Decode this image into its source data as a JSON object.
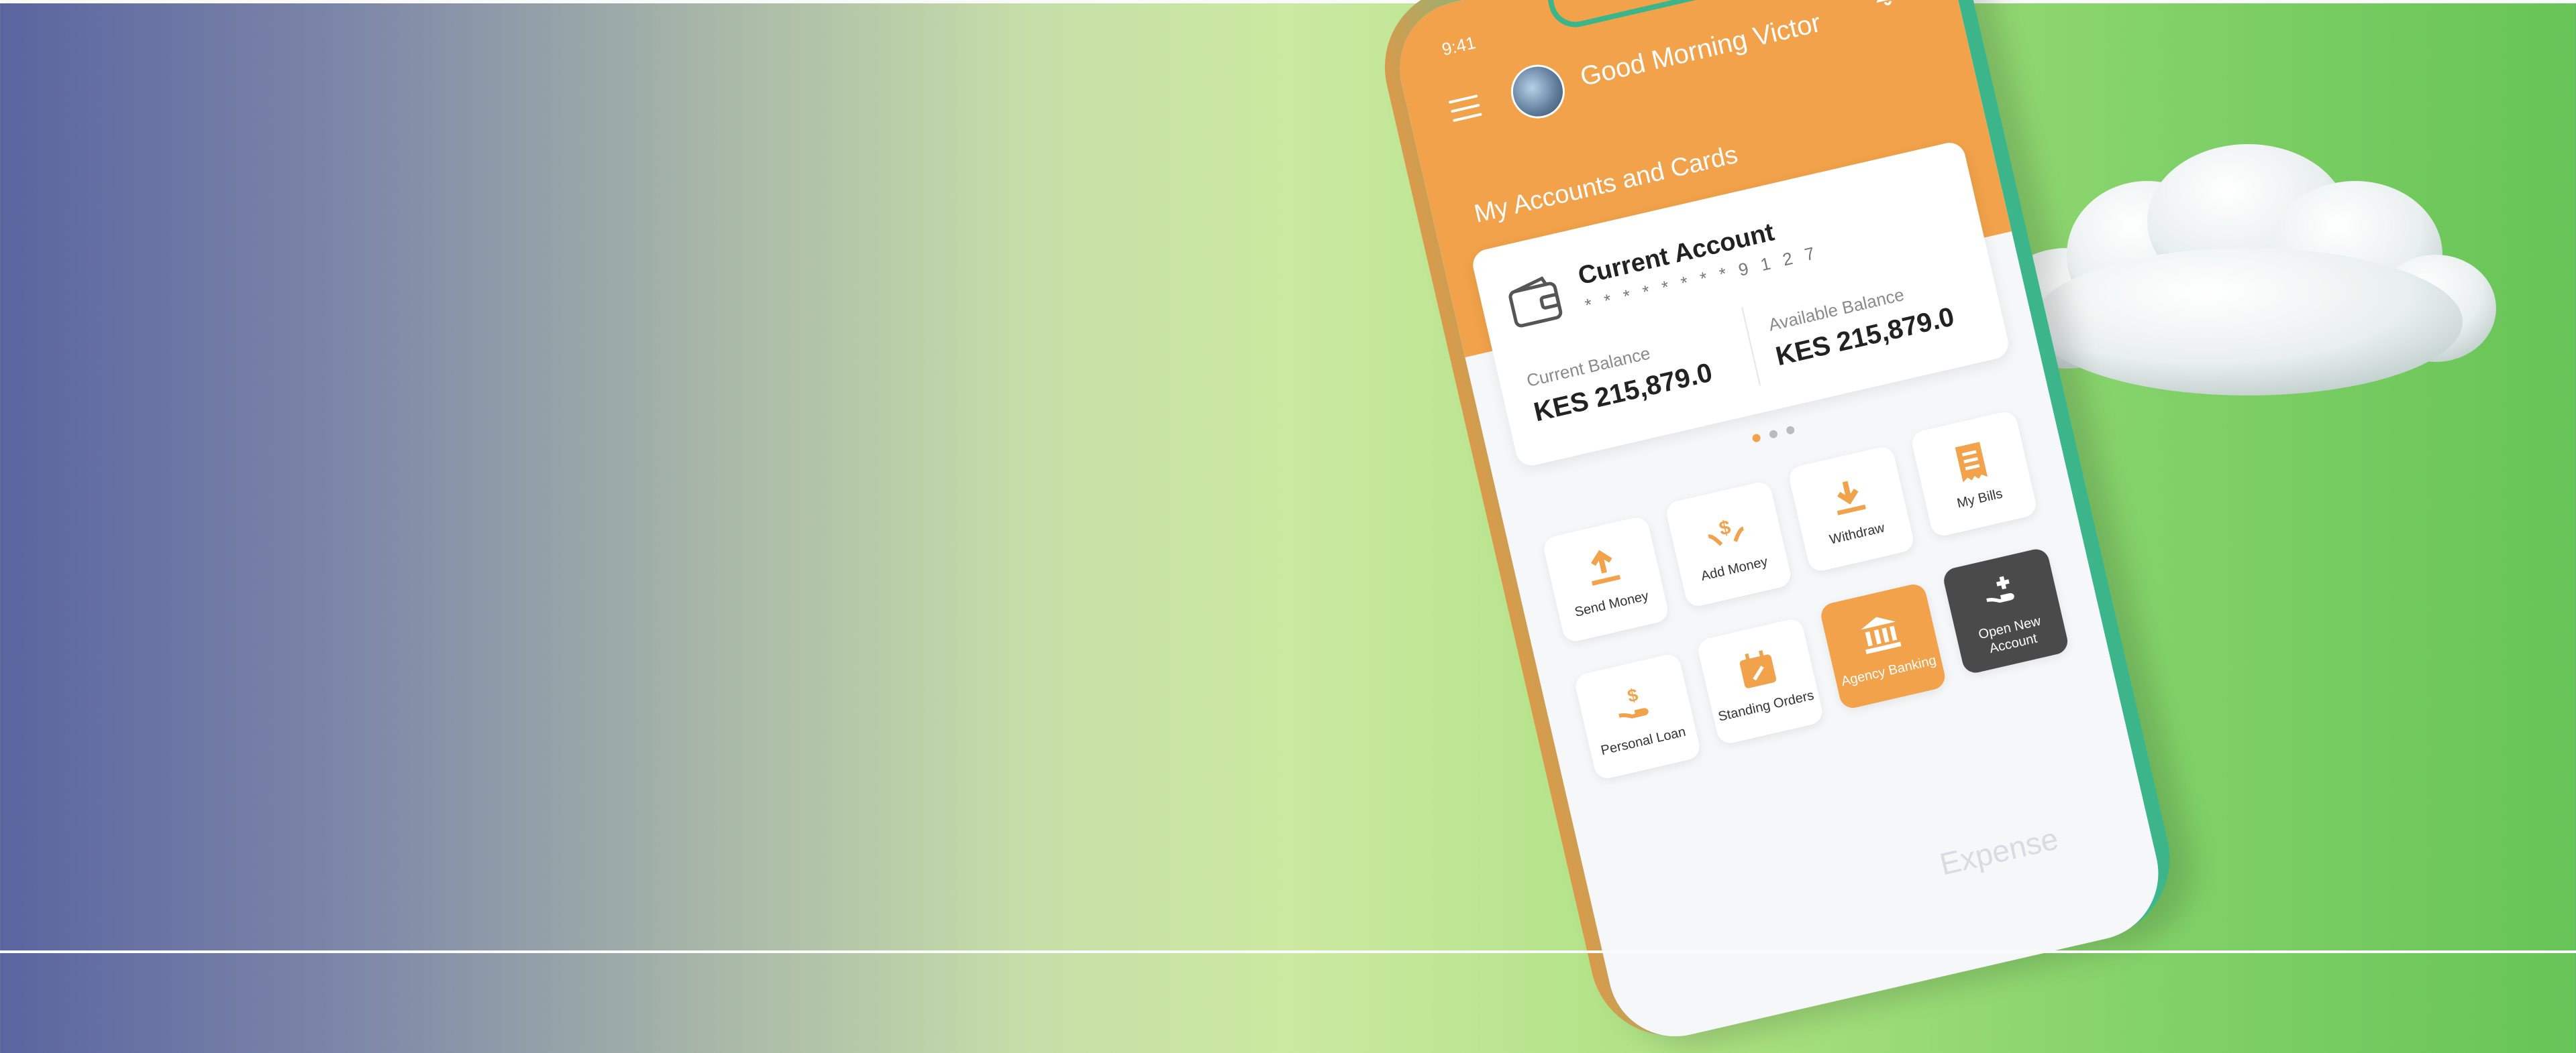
{
  "colors": {
    "accent": "#f1a24a",
    "dark_tile": "#4a4a4a",
    "phone_frame": "#3bb58a"
  },
  "status": {
    "time": "9:41"
  },
  "header": {
    "greeting": "Good Morning Victor"
  },
  "accounts": {
    "section_title": "My Accounts and Cards",
    "card": {
      "name": "Current Account",
      "number": "* * * * * * * * 9 1 2 7",
      "current_balance_label": "Current Balance",
      "current_balance_value": "KES 215,879.0",
      "available_balance_label": "Available Balance",
      "available_balance_value": "KES 215,879.0"
    },
    "pager": {
      "count": 3,
      "active_index": 0
    }
  },
  "actions": [
    {
      "label": "My Bills",
      "icon": "receipt-icon",
      "style": "white"
    },
    {
      "label": "Withdraw",
      "icon": "download-icon",
      "style": "white"
    },
    {
      "label": "Add Money",
      "icon": "hands-dollar-icon",
      "style": "white"
    },
    {
      "label": "Send Money",
      "icon": "upload-icon",
      "style": "white"
    },
    {
      "label": "Open New Account",
      "icon": "hand-plus-icon",
      "style": "dark"
    },
    {
      "label": "Agency Banking",
      "icon": "bank-icon",
      "style": "orange"
    },
    {
      "label": "Standing Orders",
      "icon": "calendar-icon",
      "style": "white"
    },
    {
      "label": "Personal Loan",
      "icon": "hand-dollar-icon",
      "style": "white"
    }
  ],
  "footer": {
    "expense_label": "Expense"
  }
}
